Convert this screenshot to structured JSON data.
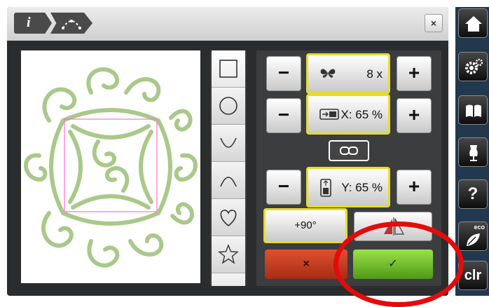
{
  "titlebar": {
    "info_label": "i",
    "close_label": "×"
  },
  "controls": {
    "count_value": "8 x",
    "x_value": "X: 65 %",
    "y_value": "Y: 65 %",
    "minus_label": "−",
    "plus_label": "+",
    "rotate_label": "+90°",
    "cancel_label": "×",
    "confirm_label": "✓"
  },
  "shapes": [
    "square",
    "circle",
    "arc-down",
    "arc-up",
    "heart",
    "star"
  ],
  "sidebar": {
    "eco_label": "eco",
    "clr_label": "clr",
    "help_label": "?"
  },
  "colors": {
    "accent": "#e6dc2a",
    "confirm": "#6fb82a",
    "cancel": "#c2391d",
    "highlight": "#e30b0b",
    "stitch": "#a9c98a",
    "frame": "#ff6fd8"
  }
}
